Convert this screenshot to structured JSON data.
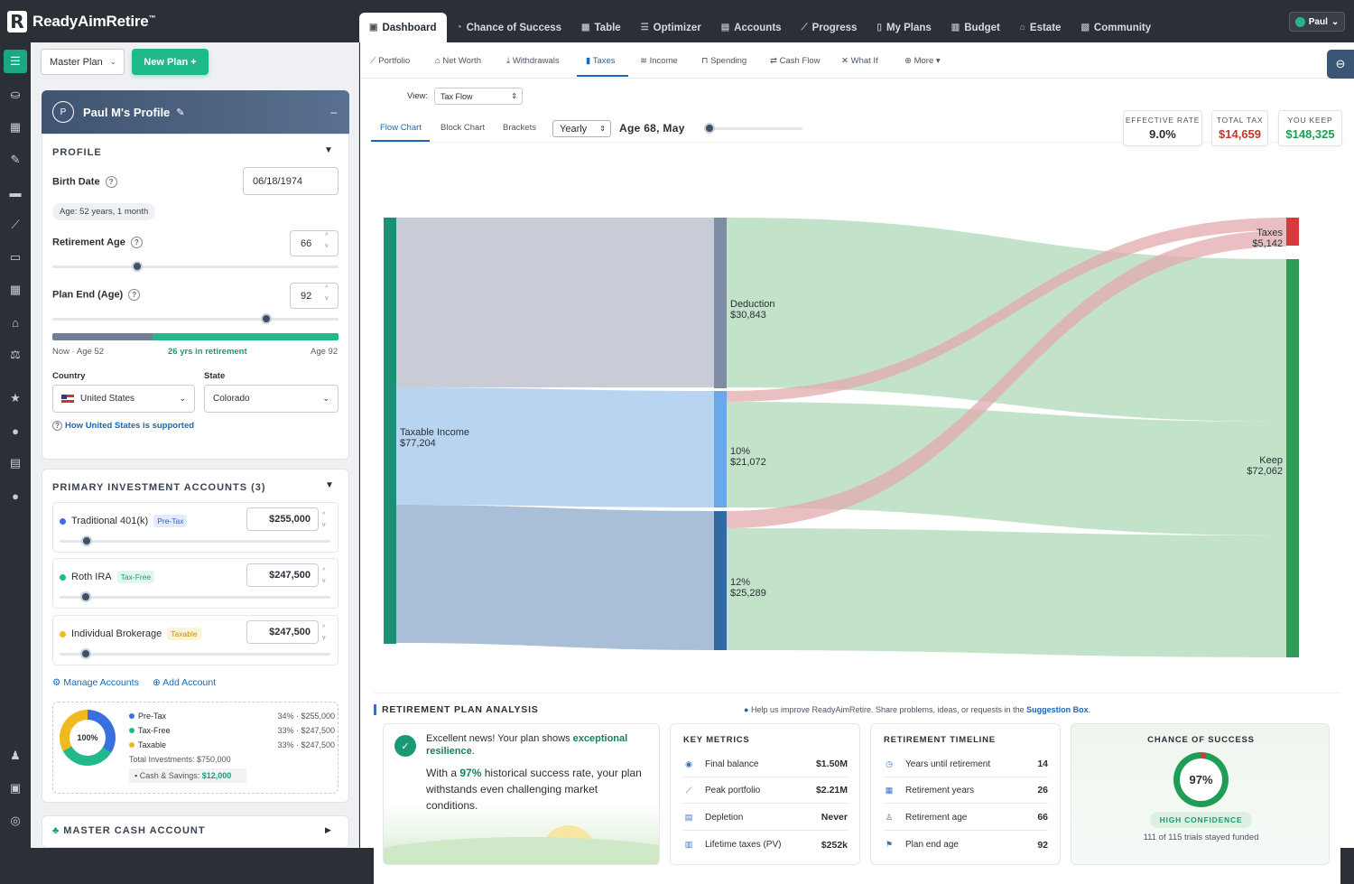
{
  "app": {
    "logo_letter": "R",
    "logo_text": "ReadyAimRetire",
    "logo_tm": "™"
  },
  "main_tabs": [
    {
      "label": "Dashboard",
      "icon": "▣"
    },
    {
      "label": "Chance of Success",
      "icon": "◔"
    },
    {
      "label": "Table",
      "icon": "▦"
    },
    {
      "label": "Optimizer",
      "icon": "☰"
    },
    {
      "label": "Accounts",
      "icon": "▤"
    },
    {
      "label": "Progress",
      "icon": "⟋"
    },
    {
      "label": "My Plans",
      "icon": "▯"
    },
    {
      "label": "Budget",
      "icon": "▥"
    },
    {
      "label": "Estate",
      "icon": "⌂"
    },
    {
      "label": "Community",
      "icon": "▧"
    }
  ],
  "user": {
    "name": "Paul"
  },
  "left": {
    "plan_select": "Master Plan",
    "new_plan": "New Plan  +",
    "profile_name": "Paul M's Profile",
    "profile_initial": "P",
    "profile_min": "–",
    "profile_section": "PROFILE",
    "birth_date_label": "Birth Date",
    "birth_date": "06/18/1974",
    "age_pill": "Age: 52 years, 1 month",
    "retirement_age_label": "Retirement Age",
    "retirement_age": "66",
    "plan_end_label": "Plan End (Age)",
    "plan_end": "92",
    "timeline_now": "Now · Age 52",
    "timeline_mid": "26 yrs in retirement",
    "timeline_end": "Age 92",
    "country_label": "Country",
    "country": "United States",
    "state_label": "State",
    "state": "Colorado",
    "support_link": "How United States is supported",
    "accounts_title": "PRIMARY INVESTMENT ACCOUNTS (3)",
    "accounts": [
      {
        "name": "Traditional 401(k)",
        "tag": "Pre-Tax",
        "value": "$255,000",
        "color": "#3a6fe0",
        "tagbg": "#e4ecfb",
        "tagfg": "#2f5ec4",
        "slider": 0.12
      },
      {
        "name": "Roth IRA",
        "tag": "Tax-Free",
        "value": "$247,500",
        "color": "#1fb98c",
        "tagbg": "#e2f6ef",
        "tagfg": "#1a9a74",
        "slider": 0.11
      },
      {
        "name": "Individual Brokerage",
        "tag": "Taxable",
        "value": "$247,500",
        "color": "#f1b91f",
        "tagbg": "#fdf3d8",
        "tagfg": "#c48e0a",
        "slider": 0.11
      }
    ],
    "manage_accounts": "Manage Accounts",
    "add_account": "Add Account",
    "donut_center": "100%",
    "alloc": [
      {
        "label": "Pre-Tax",
        "pct": "34% · $255,000",
        "color": "#3a6fe0"
      },
      {
        "label": "Tax-Free",
        "pct": "33% · $247,500",
        "color": "#1fb98c"
      },
      {
        "label": "Taxable",
        "pct": "33% · $247,500",
        "color": "#f1b91f"
      }
    ],
    "total_investments": "Total Investments: $750,000",
    "cash_label": "Cash & Savings:",
    "cash_value": "$12,000",
    "master_cash": "MASTER CASH ACCOUNT"
  },
  "sub_tabs": [
    "Portfolio",
    "Net Worth",
    "Withdrawals",
    "Taxes",
    "Income",
    "Spending",
    "Cash Flow",
    "What If",
    "More"
  ],
  "controls": {
    "view_label": "View:",
    "view_value": "Tax Flow",
    "chart_tabs": [
      "Flow Chart",
      "Block Chart",
      "Brackets"
    ],
    "period": "Yearly",
    "age_label": "Age 68, May"
  },
  "stats": {
    "effective_rate_label": "EFFECTIVE RATE",
    "effective_rate": "9.0%",
    "total_tax_label": "TOTAL TAX",
    "total_tax": "$14,659",
    "you_keep_label": "YOU KEEP",
    "you_keep": "$148,325"
  },
  "chart_data": {
    "type": "sankey",
    "nodes": [
      {
        "name": "Taxable Income",
        "value": "$77,204"
      },
      {
        "name": "Deduction",
        "value": "$30,843"
      },
      {
        "name": "10%",
        "value": "$21,072"
      },
      {
        "name": "12%",
        "value": "$25,289"
      },
      {
        "name": "Taxes",
        "value": "$5,142"
      },
      {
        "name": "Keep",
        "value": "$72,062"
      }
    ]
  },
  "analysis": {
    "title": "RETIREMENT PLAN ANALYSIS",
    "help_text": "Help us improve ReadyAimRetire. Share problems, ideas, or requests in the",
    "help_link": "Suggestion Box",
    "msg_line1_a": "Excellent news! Your plan shows",
    "msg_line1_b": "exceptional resilience",
    "msg_pre": "With a",
    "msg_pct": "97%",
    "msg_post": "historical success rate, your plan withstands even challenging market conditions.",
    "key_metrics_title": "KEY METRICS",
    "key_metrics": [
      {
        "label": "Final balance",
        "value": "$1.50M",
        "icon": "◉"
      },
      {
        "label": "Peak portfolio",
        "value": "$2.21M",
        "icon": "⟋"
      },
      {
        "label": "Depletion",
        "value": "Never",
        "icon": "▤"
      },
      {
        "label": "Lifetime taxes (PV)",
        "value": "$252k",
        "icon": "▥"
      }
    ],
    "timeline_title": "RETIREMENT TIMELINE",
    "timeline": [
      {
        "label": "Years until retirement",
        "value": "14",
        "icon": "◷"
      },
      {
        "label": "Retirement years",
        "value": "26",
        "icon": "▦"
      },
      {
        "label": "Retirement age",
        "value": "66",
        "icon": "♙"
      },
      {
        "label": "Plan end age",
        "value": "92",
        "icon": "⚑"
      }
    ],
    "chance_title": "CHANCE OF SUCCESS",
    "chance_value": "97%",
    "chance_fraction": 0.97,
    "confidence": "HIGH CONFIDENCE",
    "trials": "111 of 115 trials stayed funded"
  }
}
